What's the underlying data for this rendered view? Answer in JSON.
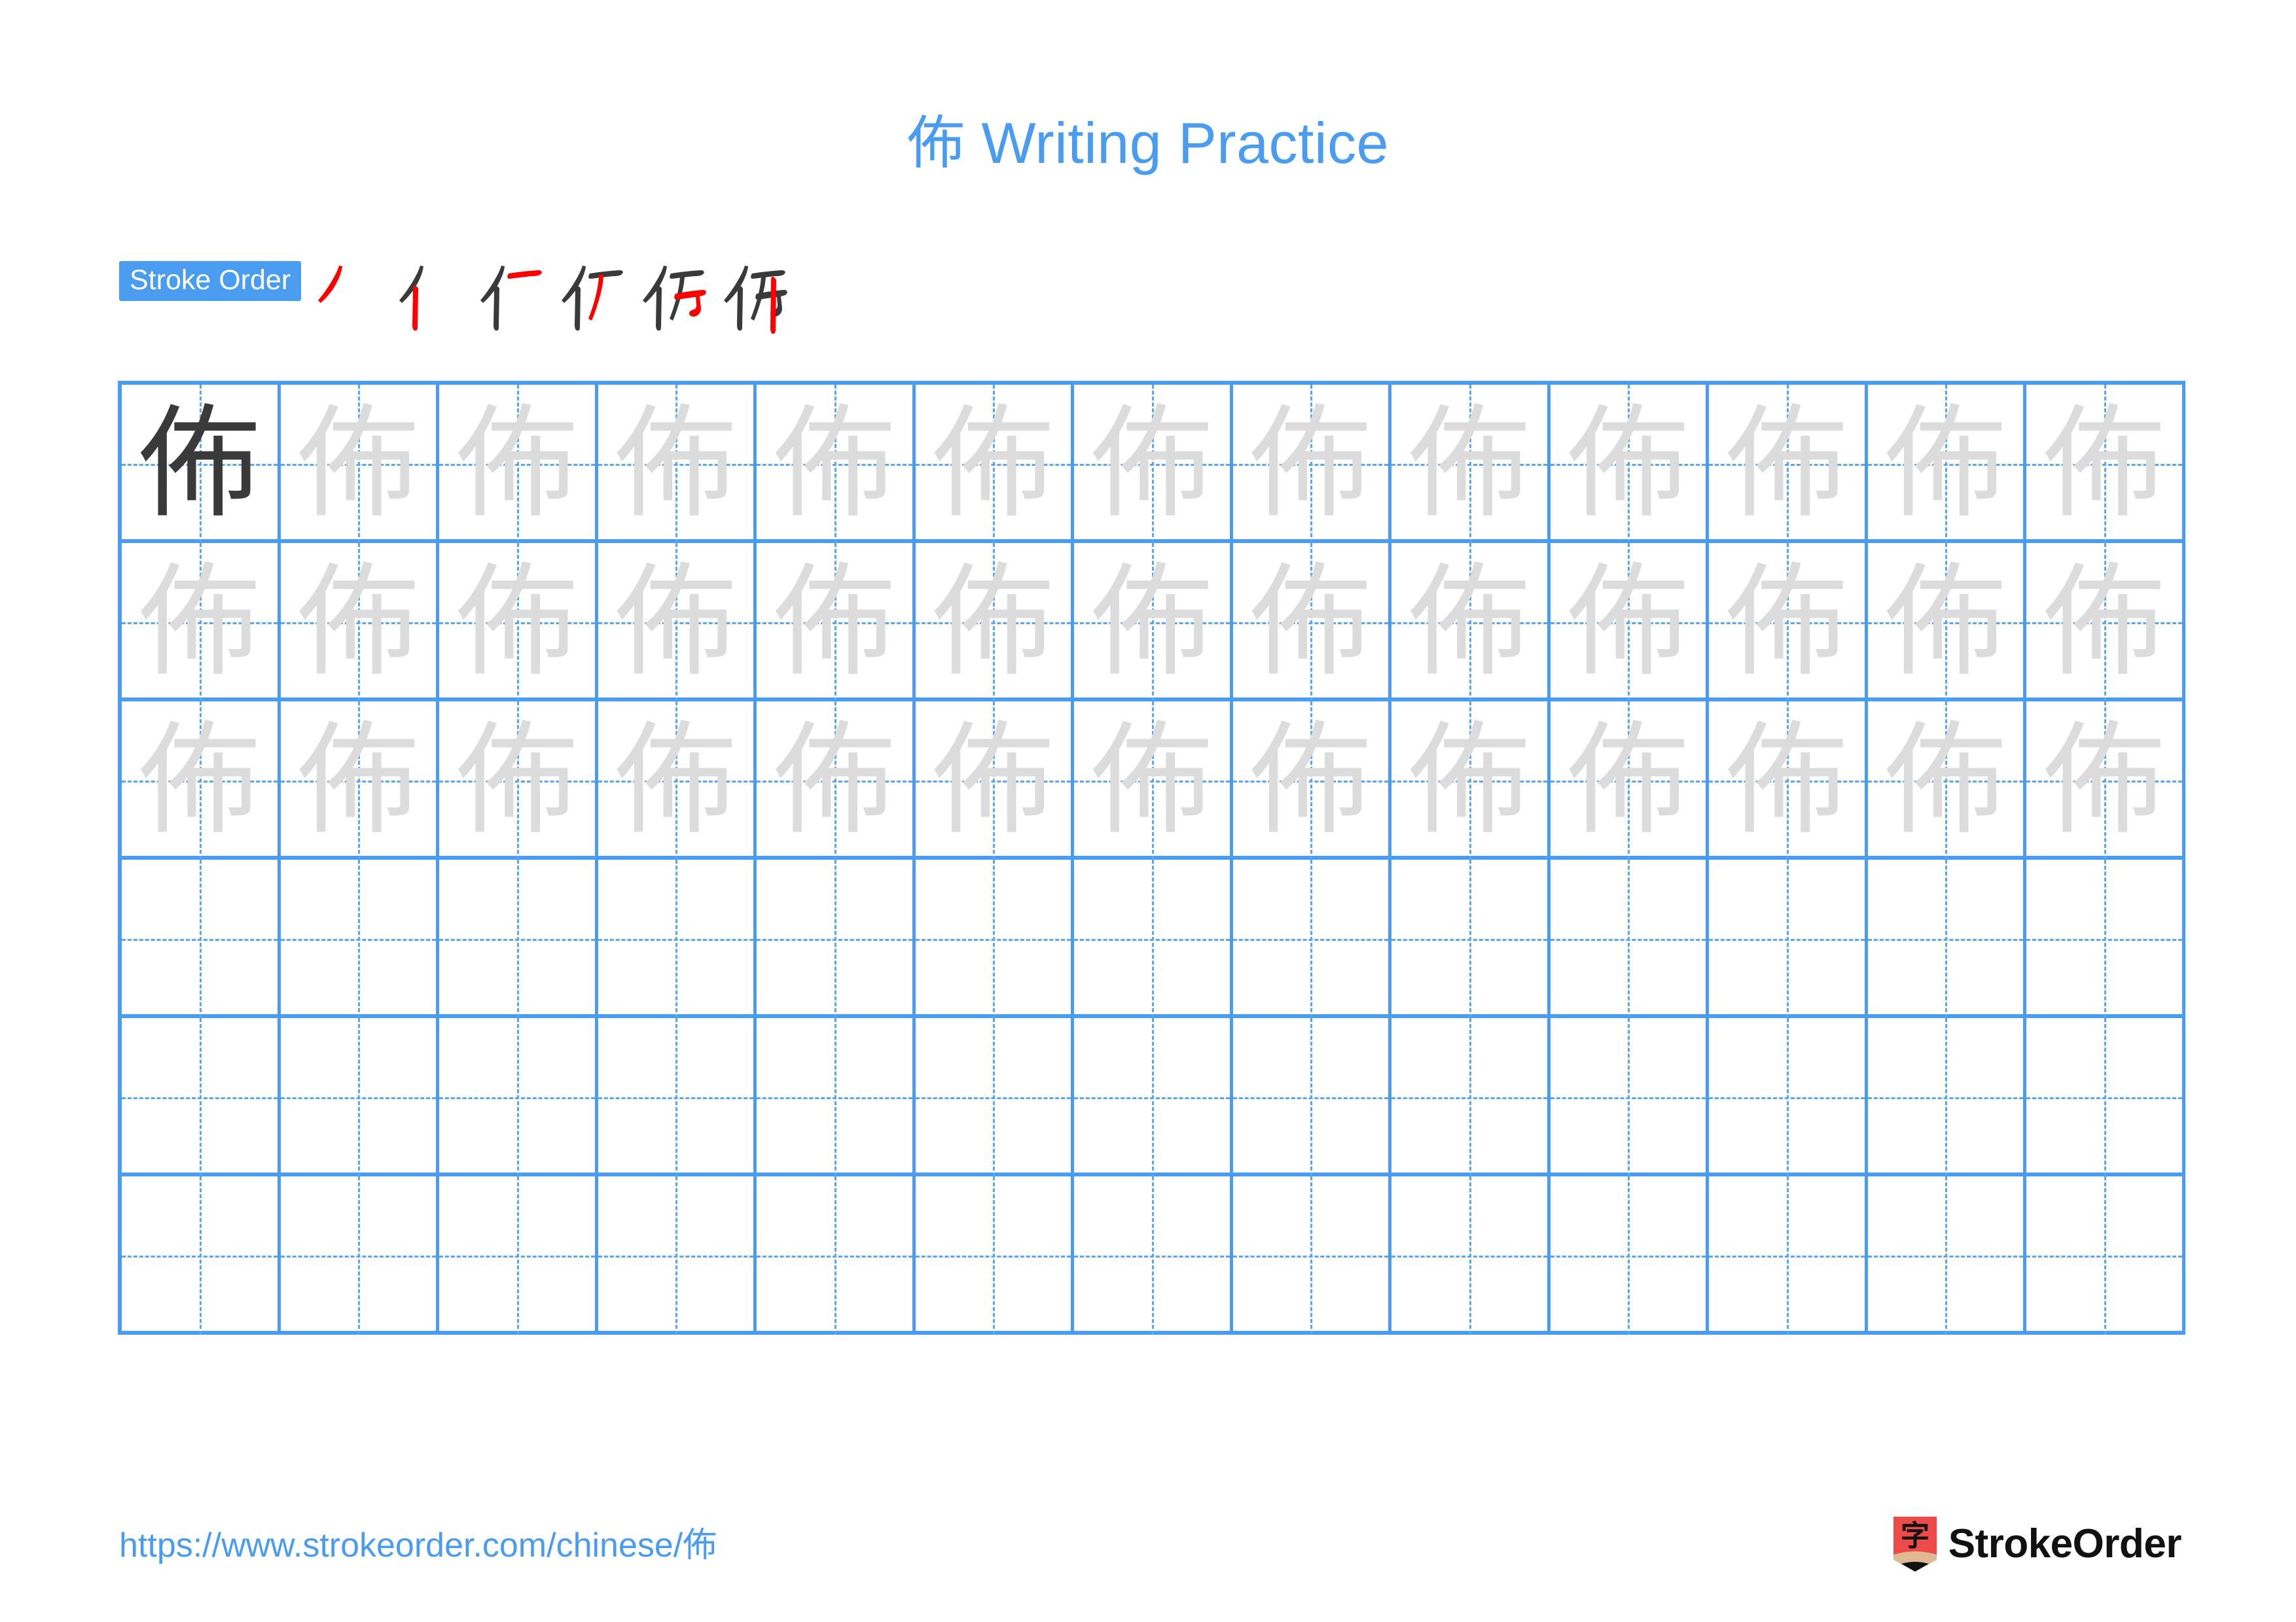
{
  "character": "佈",
  "title": {
    "character": "佈",
    "text": " Writing Practice",
    "full": "佈 Writing Practice",
    "color": "#4A9CF0"
  },
  "stroke_order": {
    "badge_label": "Stroke Order",
    "badge_bg": "#4A9CF0",
    "badge_text_color": "#FFFFFF",
    "ink_color": "#3A3A3A",
    "new_stroke_color": "#FF0000",
    "total_strokes": 6,
    "steps": [
      {
        "index": 1,
        "strokes_shown": 1,
        "new_stroke": 1,
        "name": "stroke-step-1"
      },
      {
        "index": 2,
        "strokes_shown": 2,
        "new_stroke": 2,
        "name": "stroke-step-2"
      },
      {
        "index": 3,
        "strokes_shown": 3,
        "new_stroke": 3,
        "name": "stroke-step-3"
      },
      {
        "index": 4,
        "strokes_shown": 4,
        "new_stroke": 4,
        "name": "stroke-step-4"
      },
      {
        "index": 5,
        "strokes_shown": 5,
        "new_stroke": 5,
        "name": "stroke-step-5"
      },
      {
        "index": 6,
        "strokes_shown": 6,
        "new_stroke": 6,
        "name": "stroke-step-6"
      }
    ]
  },
  "practice_grid": {
    "columns": 13,
    "rows": 6,
    "line_color": "#4A9CF0",
    "guide_color": "#5AA6F2",
    "dark_glyph_color": "#3A3A3A",
    "light_glyph_color": "#DCDCDC",
    "cells": [
      [
        "dark",
        "light",
        "light",
        "light",
        "light",
        "light",
        "light",
        "light",
        "light",
        "light",
        "light",
        "light",
        "light"
      ],
      [
        "light",
        "light",
        "light",
        "light",
        "light",
        "light",
        "light",
        "light",
        "light",
        "light",
        "light",
        "light",
        "light"
      ],
      [
        "light",
        "light",
        "light",
        "light",
        "light",
        "light",
        "light",
        "light",
        "light",
        "light",
        "light",
        "light",
        "light"
      ],
      [
        "blank",
        "blank",
        "blank",
        "blank",
        "blank",
        "blank",
        "blank",
        "blank",
        "blank",
        "blank",
        "blank",
        "blank",
        "blank"
      ],
      [
        "blank",
        "blank",
        "blank",
        "blank",
        "blank",
        "blank",
        "blank",
        "blank",
        "blank",
        "blank",
        "blank",
        "blank",
        "blank"
      ],
      [
        "blank",
        "blank",
        "blank",
        "blank",
        "blank",
        "blank",
        "blank",
        "blank",
        "blank",
        "blank",
        "blank",
        "blank",
        "blank"
      ]
    ]
  },
  "footer": {
    "url": "https://www.strokeorder.com/chinese/佈",
    "brand_name": "StrokeOrder",
    "brand_mark_character": "字",
    "brand_mark_color": "#EF4A4A",
    "brand_mark_tip_color": "#DEB992",
    "brand_text_color": "#111111"
  }
}
